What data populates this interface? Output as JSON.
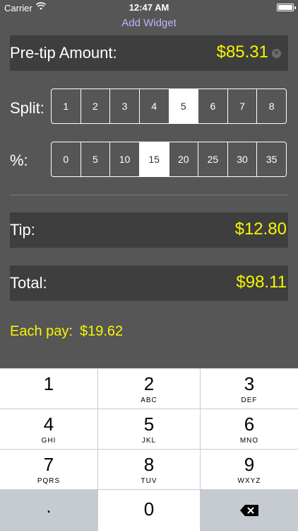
{
  "status_bar": {
    "carrier": "Carrier",
    "time": "12:47 AM",
    "wifi_icon": "wifi-icon",
    "battery_icon": "battery-icon"
  },
  "header": {
    "add_widget_label": "Add Widget"
  },
  "pretip": {
    "label": "Pre-tip Amount:",
    "value": "$85.31",
    "clear_icon": "clear-icon"
  },
  "split": {
    "label": "Split:",
    "options": [
      "1",
      "2",
      "3",
      "4",
      "5",
      "6",
      "7",
      "8"
    ],
    "selected": "5"
  },
  "percent": {
    "label": "%:",
    "options": [
      "0",
      "5",
      "10",
      "15",
      "20",
      "25",
      "30",
      "35"
    ],
    "selected": "15"
  },
  "tip": {
    "label": "Tip:",
    "value": "$12.80"
  },
  "total": {
    "label": "Total:",
    "value": "$98.11"
  },
  "each_pay": {
    "label": "Each pay:",
    "value": "$19.62"
  },
  "keypad": {
    "keys": [
      {
        "num": "1",
        "letters": ""
      },
      {
        "num": "2",
        "letters": "ABC"
      },
      {
        "num": "3",
        "letters": "DEF"
      },
      {
        "num": "4",
        "letters": "GHI"
      },
      {
        "num": "5",
        "letters": "JKL"
      },
      {
        "num": "6",
        "letters": "MNO"
      },
      {
        "num": "7",
        "letters": "PQRS"
      },
      {
        "num": "8",
        "letters": "TUV"
      },
      {
        "num": "9",
        "letters": "WXYZ"
      },
      {
        "num": ".",
        "letters": ""
      },
      {
        "num": "0",
        "letters": ""
      }
    ],
    "backspace_icon": "backspace-icon"
  },
  "colors": {
    "background": "#565656",
    "box": "#3e3e3e",
    "accent_yellow": "#f6f600",
    "link_purple": "#b8b4ff",
    "keypad_bg": "#c6cbd1"
  }
}
